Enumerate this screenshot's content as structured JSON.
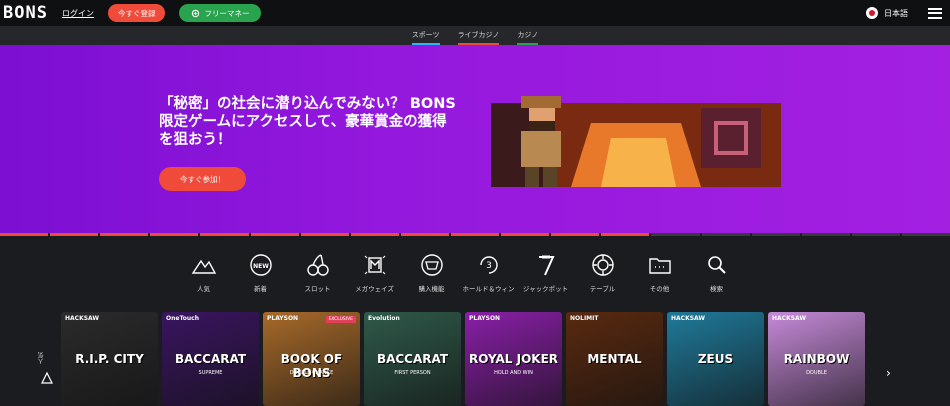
{
  "header": {
    "logo": "BONS",
    "login_label": "ログイン",
    "register_label": "今すぐ登録",
    "free_money_label": "フリーマネー",
    "language_label": "日本語"
  },
  "subnav": {
    "tabs": [
      {
        "label": "スポーツ",
        "color": "#2db4ff"
      },
      {
        "label": "ライブカジノ",
        "color": "#f04a3b"
      },
      {
        "label": "カジノ",
        "color": "#2aa34f"
      }
    ]
  },
  "hero": {
    "headline": "「秘密」の社会に潜り込んでみない？ BONS限定ゲームにアクセスして、豪華賞金の獲得を狙おう！",
    "cta_label": "今すぐ参加！"
  },
  "categories": [
    {
      "label": "人気",
      "icon": "mountain-icon"
    },
    {
      "label": "新着",
      "icon": "new-badge-icon"
    },
    {
      "label": "スロット",
      "icon": "cherry-icon"
    },
    {
      "label": "メガウェイズ",
      "icon": "megaways-icon"
    },
    {
      "label": "購入機能",
      "icon": "basket-icon"
    },
    {
      "label": "ホールド＆ウィン",
      "icon": "hold-win-icon"
    },
    {
      "label": "ジャックポット",
      "icon": "seven-icon"
    },
    {
      "label": "テーブル",
      "icon": "chip-icon"
    },
    {
      "label": "その他",
      "icon": "folder-icon"
    },
    {
      "label": "検索",
      "icon": "search-icon"
    }
  ],
  "row": {
    "label": "人気",
    "games": [
      {
        "provider": "HACKSAW",
        "title": "R.I.P. CITY",
        "subtitle": "",
        "badge": "",
        "bg": "#2b2b2b"
      },
      {
        "provider": "OneTouch",
        "title": "BACCARAT",
        "subtitle": "SUPREME",
        "badge": "",
        "bg": "#3a1560"
      },
      {
        "provider": "PLAYSON",
        "title": "BOOK OF BONS",
        "subtitle": "DOUBLE CHANCE",
        "badge": "EXCLUSIVE",
        "bg": "#a86a2a"
      },
      {
        "provider": "Evolution",
        "title": "BACCARAT",
        "subtitle": "FIRST PERSON",
        "badge": "",
        "bg": "#2f5a4a"
      },
      {
        "provider": "PLAYSON",
        "title": "ROYAL JOKER",
        "subtitle": "HOLD AND WIN",
        "badge": "",
        "bg": "#8a1fa8"
      },
      {
        "provider": "NOLIMIT",
        "title": "MENTAL",
        "subtitle": "",
        "badge": "",
        "bg": "#5a2a10"
      },
      {
        "provider": "HACKSAW",
        "title": "ZEUS",
        "subtitle": "",
        "badge": "",
        "bg": "#1f7a9a"
      },
      {
        "provider": "HACKSAW",
        "title": "RAINBOW",
        "subtitle": "DOUBLE",
        "badge": "",
        "bg": "#c58ad8"
      }
    ]
  }
}
